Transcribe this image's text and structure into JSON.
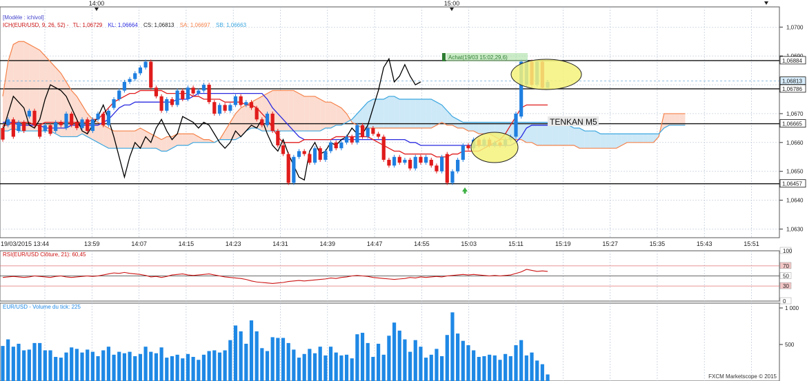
{
  "header": {
    "top_time_1": "14:00",
    "top_time_2": "15:00",
    "model": "[Modèle : ichivol]",
    "ich_label": "ICH(EUR/USD, 9, 26, 52) -",
    "tl": "TL: 1,06729",
    "kl": "KL: 1,06664",
    "cs": "CS: 1,06813",
    "sa": "SA: 1,06697",
    "sb": "SB: 1,06663"
  },
  "annotations": {
    "achat": "Achat(19/03 15:02,29,6)",
    "tenkan": "TENKAN M5"
  },
  "footer": {
    "copyright": "FXCM Marketscope © 2015"
  },
  "colors": {
    "bull": "#1f7fe0",
    "bear": "#e01b1b",
    "tenkan": "#e01b1b",
    "kijun": "#2a2ae0",
    "chikou": "#000000",
    "senkou_a": "#f5824a",
    "senkou_b": "#3aa6df",
    "cloud_bull": "#fcdcd0",
    "cloud_bear": "#cde8f7",
    "volume": "#1e88e5",
    "rsi": "#cc1111"
  },
  "chart_data": [
    {
      "type": "candlestick",
      "title": "ICH(EUR/USD, 9, 26, 52)",
      "ylim": [
        1.0627,
        1.0707
      ],
      "y_ticks": [
        "1,0700",
        "1,0690",
        "1,0680",
        "1,0670",
        "1,0660",
        "1,0650",
        "1,0640",
        "1,0630"
      ],
      "x_tick_labels": [
        "19/03/2015 13:44",
        "13:59",
        "14:07",
        "14:15",
        "14:23",
        "14:31",
        "14:39",
        "14:47",
        "14:55",
        "15:03",
        "15:11",
        "15:19",
        "15:27",
        "15:35",
        "15:43",
        "15:51"
      ],
      "h_levels": [
        1.06884,
        1.06786,
        1.06665,
        1.06457
      ],
      "price_labels": [
        "1,06884",
        "1,06813",
        "1,06786",
        "1,06665",
        "1,06457"
      ],
      "candles": [
        [
          1.0665,
          1.0661
        ],
        [
          1.0666,
          1.0668
        ],
        [
          1.0668,
          1.0662
        ],
        [
          1.0664,
          1.0667
        ],
        [
          1.0667,
          1.0664
        ],
        [
          1.0669,
          1.0671
        ],
        [
          1.0671,
          1.0666
        ],
        [
          1.0666,
          1.0662
        ],
        [
          1.0664,
          1.0666
        ],
        [
          1.0666,
          1.0663
        ],
        [
          1.0664,
          1.0667
        ],
        [
          1.0667,
          1.0666
        ],
        [
          1.0665,
          1.067
        ],
        [
          1.067,
          1.0666
        ],
        [
          1.0667,
          1.0665
        ],
        [
          1.0665,
          1.0668
        ],
        [
          1.0668,
          1.0664
        ],
        [
          1.0664,
          1.0668
        ],
        [
          1.0668,
          1.067
        ],
        [
          1.067,
          1.0666
        ],
        [
          1.0666,
          1.0671
        ],
        [
          1.0672,
          1.0675
        ],
        [
          1.0675,
          1.0678
        ],
        [
          1.0678,
          1.0681
        ],
        [
          1.0681,
          1.0682
        ],
        [
          1.0682,
          1.0684
        ],
        [
          1.0684,
          1.0686
        ],
        [
          1.0686,
          1.0688
        ],
        [
          1.0688,
          1.0679
        ],
        [
          1.0679,
          1.0676
        ],
        [
          1.0676,
          1.0671
        ],
        [
          1.0671,
          1.0675
        ],
        [
          1.0675,
          1.0673
        ],
        [
          1.0673,
          1.0678
        ],
        [
          1.0678,
          1.0675
        ],
        [
          1.0675,
          1.0679
        ],
        [
          1.0679,
          1.0677
        ],
        [
          1.0677,
          1.0678
        ],
        [
          1.0678,
          1.068
        ],
        [
          1.068,
          1.0674
        ],
        [
          1.0674,
          1.067
        ],
        [
          1.067,
          1.0673
        ],
        [
          1.0673,
          1.0671
        ],
        [
          1.0671,
          1.0673
        ],
        [
          1.0673,
          1.0676
        ],
        [
          1.0676,
          1.0673
        ],
        [
          1.0673,
          1.0674
        ],
        [
          1.0674,
          1.0672
        ],
        [
          1.0672,
          1.0668
        ],
        [
          1.0668,
          1.0666
        ],
        [
          1.0666,
          1.067
        ],
        [
          1.067,
          1.0664
        ],
        [
          1.0664,
          1.0659
        ],
        [
          1.0659,
          1.0656
        ],
        [
          1.0656,
          1.0646
        ],
        [
          1.0646,
          1.0655
        ],
        [
          1.0655,
          1.0657
        ],
        [
          1.0657,
          1.0656
        ],
        [
          1.0656,
          1.0653
        ],
        [
          1.0653,
          1.0658
        ],
        [
          1.0658,
          1.0654
        ],
        [
          1.0654,
          1.0657
        ],
        [
          1.0657,
          1.066
        ],
        [
          1.066,
          1.0658
        ],
        [
          1.0658,
          1.066
        ],
        [
          1.066,
          1.0662
        ],
        [
          1.0662,
          1.066
        ],
        [
          1.066,
          1.0666
        ],
        [
          1.0666,
          1.0662
        ],
        [
          1.0662,
          1.0665
        ],
        [
          1.0665,
          1.0663
        ],
        [
          1.0663,
          1.0662
        ],
        [
          1.0662,
          1.0654
        ],
        [
          1.0654,
          1.0652
        ],
        [
          1.0652,
          1.0655
        ],
        [
          1.0655,
          1.0653
        ],
        [
          1.0653,
          1.0654
        ],
        [
          1.0654,
          1.0651
        ],
        [
          1.0651,
          1.0655
        ],
        [
          1.0655,
          1.0653
        ],
        [
          1.0653,
          1.0655
        ],
        [
          1.0654,
          1.0652
        ],
        [
          1.0652,
          1.065
        ],
        [
          1.065,
          1.0655
        ],
        [
          1.0656,
          1.0646
        ],
        [
          1.0646,
          1.065
        ],
        [
          1.065,
          1.0654
        ],
        [
          1.0654,
          1.0659
        ],
        [
          1.0659,
          1.0658
        ],
        [
          1.0658,
          1.0661
        ],
        [
          1.0661,
          1.0659
        ],
        [
          1.0659,
          1.0661
        ],
        [
          1.0661,
          1.0659
        ],
        [
          1.0659,
          1.066
        ],
        [
          1.066,
          1.0659
        ],
        [
          1.0659,
          1.0661
        ],
        [
          1.0661,
          1.0662
        ],
        [
          1.0662,
          1.067
        ],
        [
          1.0669,
          1.0688
        ],
        [
          1.068,
          1.0688
        ],
        [
          1.0688,
          1.068
        ],
        [
          1.068,
          1.0688
        ],
        [
          1.0688,
          1.0679
        ],
        [
          1.0679,
          1.0681
        ]
      ],
      "tenkan": [
        1.0666,
        1.0666,
        1.0667,
        1.0667,
        1.0667,
        1.0667,
        1.0666,
        1.0666,
        1.0667,
        1.0667,
        1.0667,
        1.0667,
        1.0667,
        1.0667,
        1.0667,
        1.0667,
        1.0667,
        1.0668,
        1.0668,
        1.067,
        1.0672,
        1.0674,
        1.0675,
        1.0676,
        1.0677,
        1.0677,
        1.0678,
        1.0678,
        1.0678,
        1.0678,
        1.0678,
        1.0677,
        1.0677,
        1.0677,
        1.0677,
        1.0677,
        1.0676,
        1.0676,
        1.0675,
        1.0675,
        1.0675,
        1.0675,
        1.0674,
        1.0674,
        1.0674,
        1.0674,
        1.0673,
        1.0673,
        1.0672,
        1.067,
        1.0668,
        1.0665,
        1.0662,
        1.066,
        1.066,
        1.066,
        1.066,
        1.0661,
        1.0661,
        1.0661,
        1.0661,
        1.0661,
        1.0661,
        1.0662,
        1.0662,
        1.0662,
        1.0662,
        1.0662,
        1.0662,
        1.0662,
        1.0661,
        1.066,
        1.0659,
        1.0658,
        1.0657,
        1.0657,
        1.0656,
        1.0656,
        1.0656,
        1.0656,
        1.0656,
        1.0656,
        1.0655,
        1.0655,
        1.0655,
        1.0656,
        1.0656,
        1.0657,
        1.0657,
        1.0657,
        1.0657,
        1.0658,
        1.0659,
        1.066,
        1.0661,
        1.0663,
        1.0666,
        1.0669,
        1.0672,
        1.0673,
        1.0673,
        1.0673,
        1.0673,
        1.0673
      ],
      "kijun": [
        1.0667,
        1.0667,
        1.0667,
        1.0666,
        1.0666,
        1.0666,
        1.0666,
        1.0666,
        1.0665,
        1.0665,
        1.0665,
        1.0665,
        1.0665,
        1.0666,
        1.0666,
        1.0666,
        1.0666,
        1.0666,
        1.0666,
        1.0667,
        1.0668,
        1.067,
        1.0672,
        1.0673,
        1.0673,
        1.0674,
        1.0674,
        1.0674,
        1.0674,
        1.0674,
        1.0674,
        1.0674,
        1.0674,
        1.0675,
        1.0675,
        1.0675,
        1.0676,
        1.0677,
        1.0677,
        1.0677,
        1.0677,
        1.0677,
        1.0677,
        1.0677,
        1.0677,
        1.0677,
        1.0677,
        1.0677,
        1.0677,
        1.0677,
        1.0675,
        1.0672,
        1.067,
        1.0668,
        1.0666,
        1.0664,
        1.0662,
        1.0661,
        1.0661,
        1.0661,
        1.0661,
        1.0661,
        1.0661,
        1.0661,
        1.0661,
        1.0661,
        1.0661,
        1.0661,
        1.0661,
        1.0661,
        1.0661,
        1.0661,
        1.0661,
        1.0661,
        1.0661,
        1.0661,
        1.0661,
        1.066,
        1.066,
        1.0659,
        1.0659,
        1.0659,
        1.0659,
        1.0659,
        1.0659,
        1.0659,
        1.0659,
        1.0659,
        1.0659,
        1.0659,
        1.0659,
        1.0659,
        1.0659,
        1.0659,
        1.0659,
        1.0659,
        1.0659,
        1.066,
        1.0662,
        1.0665,
        1.0666,
        1.0666,
        1.0666,
        1.0666
      ],
      "chikou": [
        1.0664,
        1.067,
        1.0676,
        1.0674,
        1.0672,
        1.0666,
        1.0665,
        1.0668,
        1.0675,
        1.068,
        1.0679,
        1.0678,
        1.0676,
        1.0672,
        1.0668,
        1.0664,
        1.0663,
        1.0666,
        1.0669,
        1.0673,
        1.0668,
        1.0662,
        1.0655,
        1.0648,
        1.0655,
        1.066,
        1.0658,
        1.0662,
        1.066,
        1.0665,
        1.0668,
        1.0664,
        1.0661,
        1.0663,
        1.0669,
        1.0668,
        1.0667,
        1.0665,
        1.0667,
        1.0666,
        1.0663,
        1.066,
        1.0658,
        1.066,
        1.0664,
        1.0662,
        1.0664,
        1.0666,
        1.0665,
        1.0668,
        1.0663,
        1.0659,
        1.0657,
        1.0661,
        1.0656,
        1.0652,
        1.0648,
        1.0647,
        1.0657,
        1.066,
        1.0656,
        1.0657,
        1.066,
        1.0659,
        1.0661,
        1.0662,
        1.0665,
        1.0663,
        1.0663,
        1.0666,
        1.0672,
        1.0678,
        1.0686,
        1.0689,
        1.0681,
        1.0683,
        1.0687,
        1.0683,
        1.068,
        1.0681
      ],
      "senkou_a": [
        1.0676,
        1.0688,
        1.0694,
        1.0695,
        1.0695,
        1.0694,
        1.0693,
        1.0692,
        1.069,
        1.0688,
        1.0686,
        1.0684,
        1.0681,
        1.0678,
        1.0676,
        1.0673,
        1.067,
        1.0668,
        1.0667,
        1.0666,
        1.0665,
        1.0664,
        1.0664,
        1.0664,
        1.0664,
        1.0664,
        1.0665,
        1.0664,
        1.0663,
        1.0662,
        1.0661,
        1.0662,
        1.0662,
        1.0663,
        1.0663,
        1.0663,
        1.0663,
        1.0662,
        1.0661,
        1.0661,
        1.066,
        1.0661,
        1.0664,
        1.0667,
        1.067,
        1.0672,
        1.0673,
        1.0674,
        1.0675,
        1.0676,
        1.0677,
        1.0678,
        1.0678,
        1.0678,
        1.0678,
        1.0678,
        1.0677,
        1.0676,
        1.0676,
        1.0676,
        1.0675,
        1.0674,
        1.0674,
        1.0673,
        1.0672,
        1.067,
        1.0667,
        1.0666,
        1.0665,
        1.0665,
        1.0665,
        1.0665,
        1.0665,
        1.0665,
        1.0665,
        1.0665,
        1.0665,
        1.0665,
        1.0665,
        1.0665,
        1.0665,
        1.0665,
        1.0666,
        1.0667,
        1.0666,
        1.0666,
        1.0665,
        1.0665,
        1.0664,
        1.0664,
        1.0663,
        1.0663,
        1.0663,
        1.0662,
        1.0661,
        1.0661,
        1.0661,
        1.0661,
        1.0661,
        1.066,
        1.066,
        1.0659,
        1.0659,
        1.0659,
        1.0659,
        1.0659,
        1.0659,
        1.0659,
        1.0659,
        1.0658,
        1.0658,
        1.0658,
        1.0658,
        1.0658,
        1.0658,
        1.0658,
        1.0658,
        1.0659,
        1.066,
        1.066,
        1.066,
        1.066,
        1.066,
        1.066,
        1.0662,
        1.067,
        1.067,
        1.067,
        1.067,
        1.067
      ],
      "senkou_b": [
        1.0664,
        1.0664,
        1.0665,
        1.0664,
        1.0664,
        1.0664,
        1.0664,
        1.0664,
        1.0664,
        1.0664,
        1.0663,
        1.0662,
        1.0662,
        1.0662,
        1.0662,
        1.0663,
        1.0662,
        1.0661,
        1.066,
        1.0659,
        1.0658,
        1.0658,
        1.0658,
        1.0658,
        1.0658,
        1.0658,
        1.0658,
        1.0658,
        1.0658,
        1.0658,
        1.0657,
        1.0657,
        1.0658,
        1.0659,
        1.0659,
        1.0659,
        1.066,
        1.066,
        1.066,
        1.066,
        1.066,
        1.0661,
        1.0661,
        1.0661,
        1.0661,
        1.0662,
        1.0664,
        1.0665,
        1.0665,
        1.0664,
        1.0664,
        1.0664,
        1.0664,
        1.0664,
        1.0664,
        1.0664,
        1.0664,
        1.0664,
        1.0664,
        1.0664,
        1.0664,
        1.0665,
        1.0665,
        1.0666,
        1.0666,
        1.0667,
        1.0668,
        1.067,
        1.0672,
        1.0674,
        1.0675,
        1.0675,
        1.0675,
        1.0676,
        1.0676,
        1.0675,
        1.0675,
        1.0675,
        1.0675,
        1.0675,
        1.0675,
        1.0675,
        1.0674,
        1.0673,
        1.0671,
        1.0669,
        1.0668,
        1.0667,
        1.0667,
        1.0667,
        1.0667,
        1.0667,
        1.0667,
        1.0667,
        1.0667,
        1.0667,
        1.0667,
        1.0667,
        1.0667,
        1.0667,
        1.0667,
        1.0667,
        1.0667,
        1.0667,
        1.0667,
        1.0667,
        1.0666,
        1.0666,
        1.0665,
        1.0665,
        1.0664,
        1.0664,
        1.0664,
        1.0663,
        1.0663,
        1.0663,
        1.0663,
        1.0663,
        1.0663,
        1.0663,
        1.0663,
        1.0663,
        1.0663,
        1.0663,
        1.0663,
        1.0665,
        1.0666,
        1.0666,
        1.0666,
        1.0666
      ]
    },
    {
      "type": "line",
      "title": "RSI(EUR/USD Clôture, 21): 60,45",
      "ylim": [
        0,
        100
      ],
      "y_ticks": [
        "100",
        "70",
        "50",
        "30",
        "0"
      ],
      "levels": [
        70,
        50,
        30
      ],
      "values": [
        47,
        48,
        49,
        48,
        47,
        48,
        50,
        49,
        48,
        47,
        49,
        50,
        48,
        47,
        48,
        49,
        50,
        49,
        50,
        52,
        54,
        56,
        55,
        57,
        55,
        54,
        53,
        51,
        48,
        49,
        47,
        49,
        52,
        53,
        54,
        52,
        51,
        52,
        53,
        54,
        52,
        50,
        48,
        47,
        46,
        45,
        43,
        40,
        38,
        37,
        36,
        35,
        36,
        37,
        39,
        40,
        41,
        40,
        41,
        42,
        43,
        44,
        46,
        45,
        47,
        48,
        50,
        51,
        50,
        49,
        47,
        46,
        45,
        44,
        43,
        44,
        45,
        47,
        46,
        48,
        47,
        48,
        49,
        48,
        50,
        51,
        52,
        53,
        52,
        53,
        52,
        51,
        50,
        51,
        50,
        51,
        52,
        55,
        58,
        63,
        61,
        59,
        60,
        59
      ]
    },
    {
      "type": "bar",
      "title": "EUR/USD - Volume du tick: 225",
      "ylim": [
        0,
        1000
      ],
      "y_ticks": [
        "1 000",
        "500"
      ],
      "values": [
        480,
        570,
        470,
        510,
        420,
        430,
        520,
        520,
        420,
        420,
        330,
        320,
        390,
        460,
        440,
        390,
        430,
        400,
        340,
        420,
        470,
        360,
        400,
        380,
        400,
        340,
        370,
        470,
        400,
        380,
        460,
        320,
        340,
        360,
        310,
        370,
        330,
        290,
        360,
        410,
        420,
        390,
        420,
        560,
        760,
        680,
        510,
        830,
        680,
        450,
        410,
        600,
        590,
        590,
        520,
        430,
        320,
        370,
        440,
        380,
        470,
        350,
        470,
        390,
        350,
        360,
        310,
        640,
        660,
        520,
        330,
        510,
        360,
        620,
        800,
        690,
        570,
        400,
        560,
        470,
        320,
        360,
        440,
        340,
        630,
        940,
        650,
        550,
        490,
        420,
        330,
        340,
        360,
        350,
        290,
        370,
        340,
        490,
        560,
        350,
        390,
        280,
        230,
        90
      ]
    }
  ]
}
